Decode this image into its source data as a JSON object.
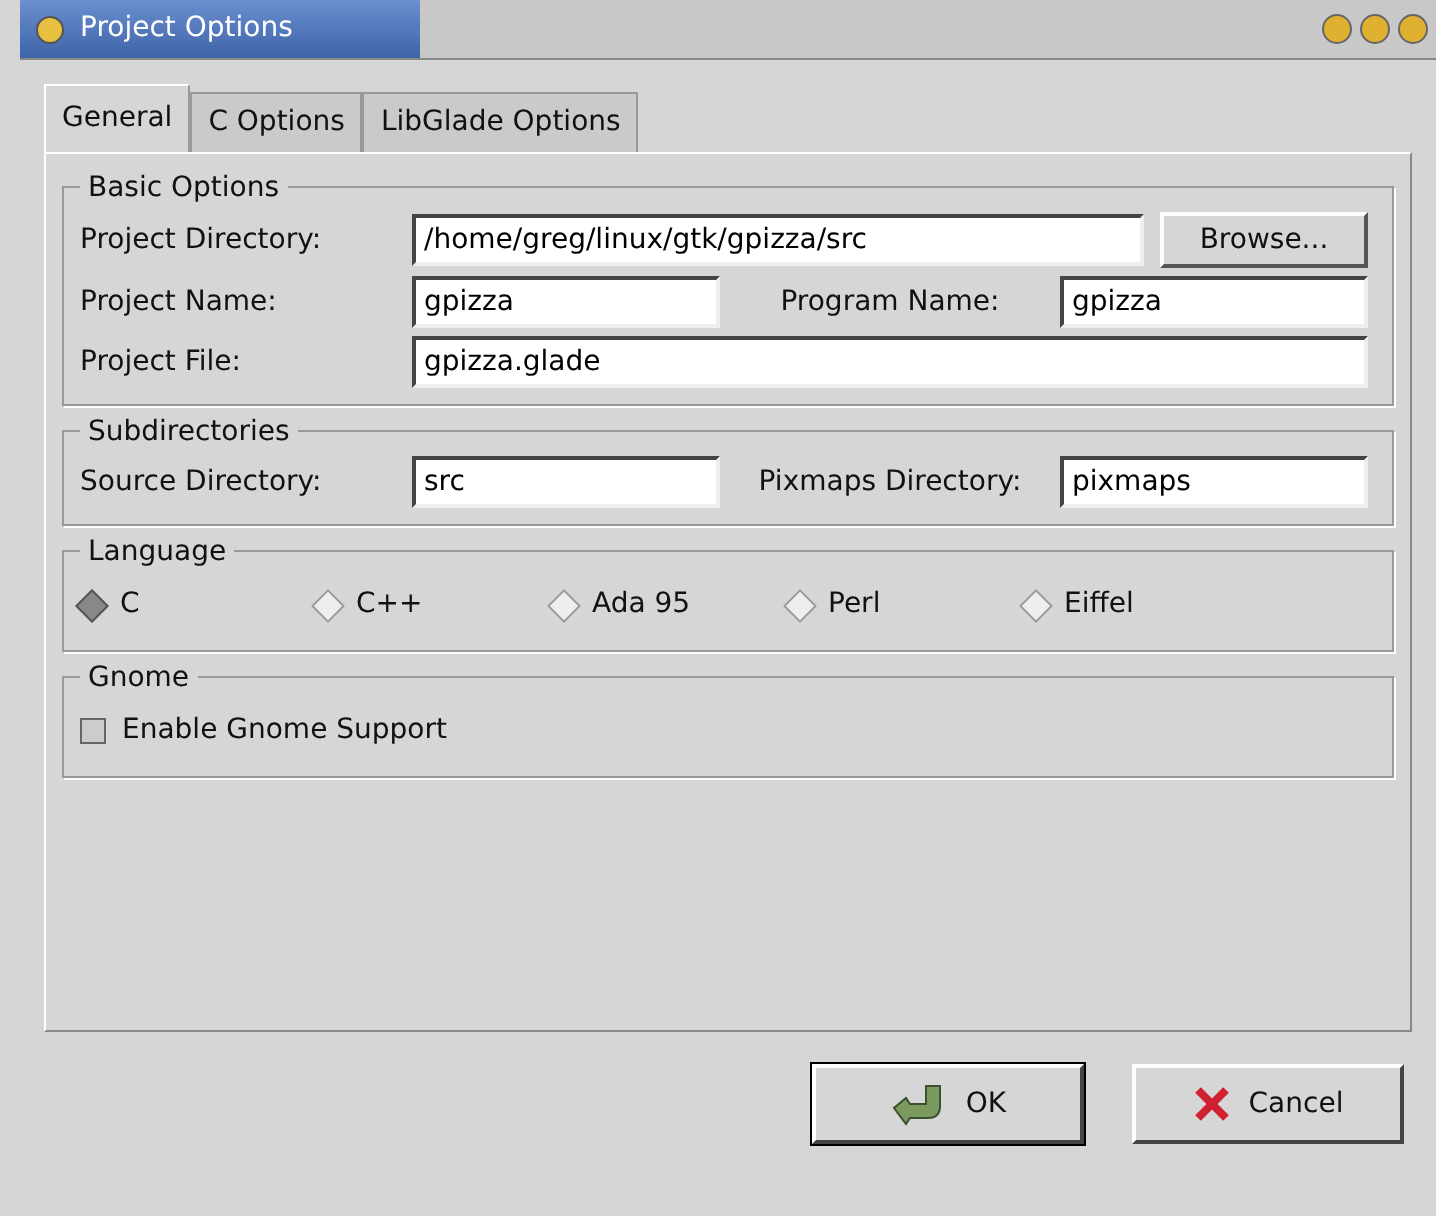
{
  "window": {
    "title": "Project Options"
  },
  "tabs": [
    {
      "label": "General",
      "selected": true
    },
    {
      "label": "C Options",
      "selected": false
    },
    {
      "label": "LibGlade Options",
      "selected": false
    }
  ],
  "basic_options": {
    "title": "Basic Options",
    "project_directory": {
      "label": "Project Directory:",
      "value": "/home/greg/linux/gtk/gpizza/src"
    },
    "browse_button": "Browse...",
    "project_name": {
      "label": "Project Name:",
      "value": "gpizza"
    },
    "program_name": {
      "label": "Program Name:",
      "value": "gpizza"
    },
    "project_file": {
      "label": "Project File:",
      "value": "gpizza.glade"
    }
  },
  "subdirectories": {
    "title": "Subdirectories",
    "source_directory": {
      "label": "Source Directory:",
      "value": "src"
    },
    "pixmaps_directory": {
      "label": "Pixmaps Directory:",
      "value": "pixmaps"
    }
  },
  "language": {
    "title": "Language",
    "options": [
      {
        "label": "C",
        "selected": true
      },
      {
        "label": "C++",
        "selected": false
      },
      {
        "label": "Ada 95",
        "selected": false
      },
      {
        "label": "Perl",
        "selected": false
      },
      {
        "label": "Eiffel",
        "selected": false
      }
    ]
  },
  "gnome": {
    "title": "Gnome",
    "enable_support": {
      "label": "Enable Gnome Support",
      "checked": false
    }
  },
  "buttons": [
    {
      "kind": "ok",
      "label": "OK"
    },
    {
      "kind": "cancel",
      "label": "Cancel"
    }
  ]
}
